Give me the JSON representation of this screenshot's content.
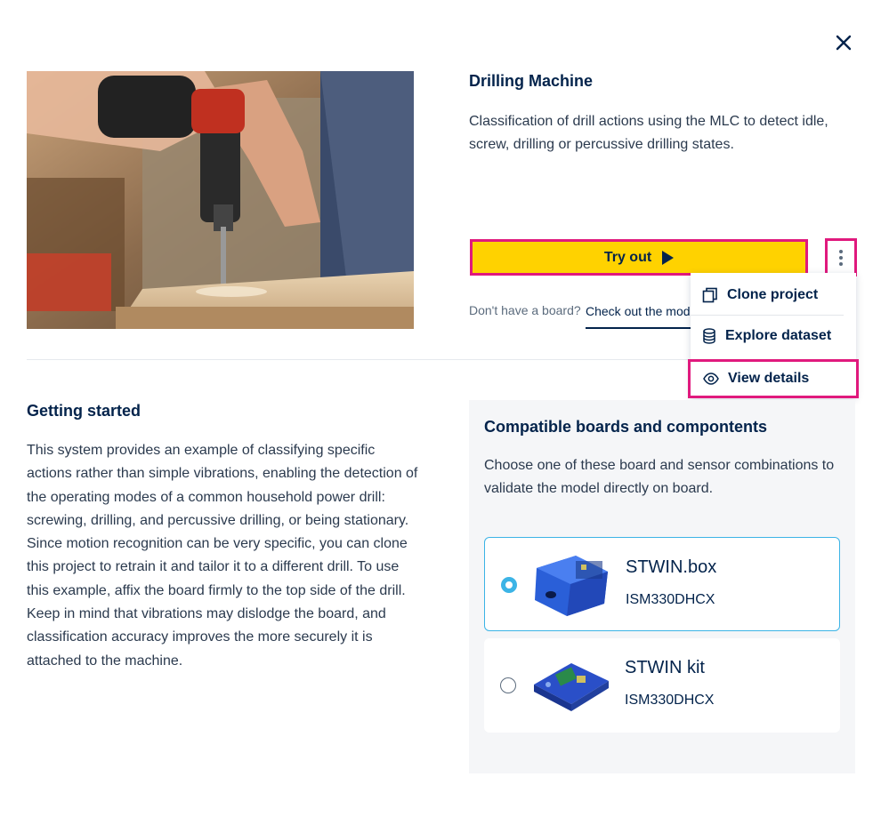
{
  "project": {
    "title": "Drilling Machine",
    "description": "Classification of drill actions using the MLC to detect idle, screw, drilling or percussive drilling states."
  },
  "actions": {
    "try_out_label": "Try out",
    "no_board_text": "Don't have a board?",
    "check_out_link": "Check out the models"
  },
  "menu": {
    "items": [
      {
        "label": "Clone project",
        "icon": "copy-icon"
      },
      {
        "label": "Explore dataset",
        "icon": "database-icon"
      },
      {
        "label": "View details",
        "icon": "eye-icon"
      }
    ]
  },
  "getting_started": {
    "title": "Getting started",
    "body": "This system provides an example of classifying specific actions rather than simple vibrations, enabling the detection of the operating modes of a common household power drill: screwing, drilling, and percussive drilling, or being stationary. Since motion recognition can be very specific, you can clone this project to retrain it and tailor it to a different drill. To use this example, affix the board firmly to the top side of the drill. Keep in mind that vibrations may dislodge the board, and classification accuracy improves the more securely it is attached to the machine."
  },
  "compatible": {
    "title": "Compatible boards and compontents",
    "description": "Choose one of these board and sensor combinations to validate the model directly on board.",
    "boards": [
      {
        "name": "STWIN.box",
        "sensor": "ISM330DHCX",
        "selected": true
      },
      {
        "name": "STWIN kit",
        "sensor": "ISM330DHCX",
        "selected": false
      }
    ]
  },
  "colors": {
    "primary_navy": "#03234b",
    "accent_yellow": "#ffd200",
    "highlight_magenta": "#e0197d",
    "selection_blue": "#3cb4e6"
  }
}
